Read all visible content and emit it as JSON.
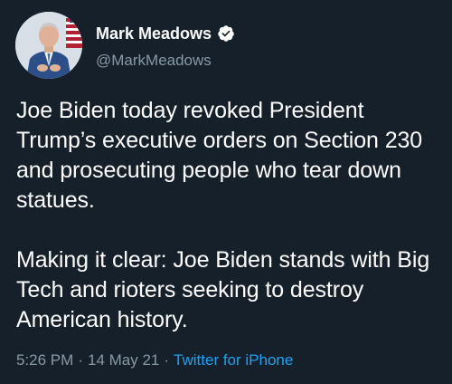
{
  "author": {
    "display_name": "Mark Meadows",
    "handle": "@MarkMeadows",
    "verified": true,
    "avatar_icon": "profile-photo"
  },
  "tweet": {
    "text": "Joe Biden today revoked President Trump’s executive orders on Section 230 and prosecuting people who tear down statues.\n\nMaking it clear: Joe Biden stands with Big Tech and rioters seeking to destroy American history.",
    "time": "5:26 PM",
    "date": "14 May 21",
    "separator": "·",
    "source": "Twitter for iPhone"
  },
  "colors": {
    "background": "#15202b",
    "text": "#ffffff",
    "muted": "#8899a6",
    "accent": "#1da1f2"
  }
}
